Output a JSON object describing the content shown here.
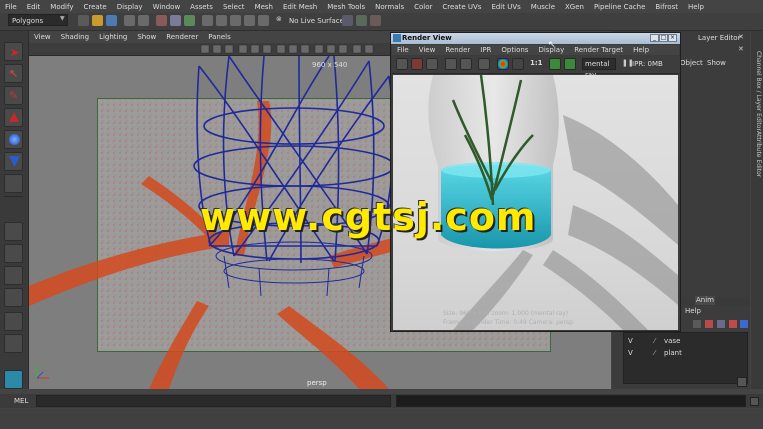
{
  "main_menu": [
    "File",
    "Edit",
    "Modify",
    "Create",
    "Display",
    "Window",
    "Assets",
    "Select",
    "Mesh",
    "Edit Mesh",
    "Mesh Tools",
    "Normals",
    "Color",
    "Create UVs",
    "Edit UVs",
    "Muscle",
    "XGen",
    "Pipeline Cache",
    "Bifrost",
    "Help"
  ],
  "status_line": {
    "mode": "Polygons",
    "live_surface": "No Live Surface"
  },
  "viewport": {
    "menu": [
      "View",
      "Shading",
      "Lighting",
      "Show",
      "Renderer",
      "Panels"
    ],
    "resolution_label": "960 x 540",
    "camera_label": "persp"
  },
  "render_view": {
    "title": "Render View",
    "menu": [
      "File",
      "View",
      "Render",
      "IPR",
      "Options",
      "Display",
      "Render Target",
      "Help"
    ],
    "ratio": "1:1",
    "renderer": "mental ray",
    "ipr_label": "IPR: 0MB",
    "info_line1": "Size: 960 x 540  zoom: 1.000      (mental ray)",
    "info_line2": "Frame: 1     Render Time: 0:49       Camera: persp",
    "window_controls": [
      "_",
      "□",
      "×"
    ]
  },
  "channel_box": {
    "header": "Layer Editor",
    "menu_object": "Object",
    "menu_show": "Show",
    "anim_tab": "Anim",
    "help": "Help",
    "layers": [
      {
        "visible": "V",
        "name": "vase"
      },
      {
        "visible": "V",
        "name": "plant"
      }
    ]
  },
  "side_tabs": [
    "Channel Box / Layer Editor",
    "Attribute Editor"
  ],
  "mel_label": "MEL",
  "watermark": "www.cgtsj.com",
  "colors": {
    "wireframe": "#1f2a9a",
    "particles": "#d03a10",
    "water": "#37c6d8",
    "plant": "#2f5a2a",
    "watermark": "#ffea00"
  }
}
